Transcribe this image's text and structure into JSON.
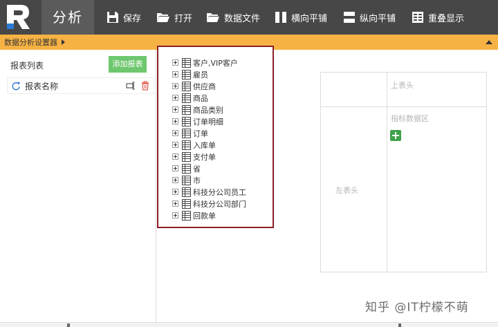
{
  "toolbar": {
    "app_title": "分析",
    "buttons": [
      {
        "label": "保存",
        "icon": "save-icon"
      },
      {
        "label": "打开",
        "icon": "folder-icon"
      },
      {
        "label": "数据文件",
        "icon": "folder-icon"
      },
      {
        "label": "横向平铺",
        "icon": "tile-horizontal-icon"
      },
      {
        "label": "纵向平铺",
        "icon": "tile-vertical-icon"
      },
      {
        "label": "重叠显示",
        "icon": "overlap-icon"
      }
    ]
  },
  "section_bar": {
    "label": "数据分析设置器"
  },
  "left_panel": {
    "title": "报表列表",
    "add_button": "添加报表",
    "reports": [
      {
        "name": "报表名称"
      }
    ]
  },
  "tree": {
    "items": [
      "客户,VIP客户",
      "雇员",
      "供应商",
      "商品",
      "商品类别",
      "订单明细",
      "订单",
      "入库单",
      "支付单",
      "省",
      "市",
      "科技分公司员工",
      "科技分公司部门",
      "回款单"
    ]
  },
  "layout_grid": {
    "top_header": "上表头",
    "metric_area": "指标数据区",
    "left_header": "左表头"
  },
  "watermark": "知乎 @IT柠檬不萌",
  "colors": {
    "toolbar_bg": "#474747",
    "section_bar_bg": "#f7b244",
    "add_button_bg": "#6ec76e",
    "tree_frame_border": "#8a1f24",
    "add_metric_bg": "#3ea14b"
  }
}
